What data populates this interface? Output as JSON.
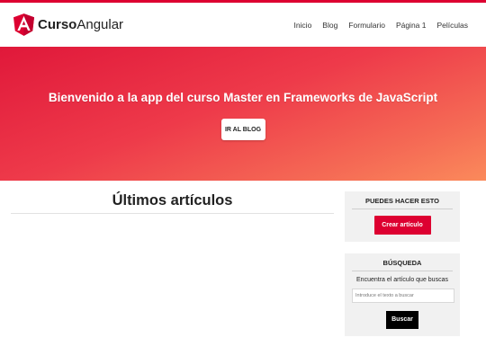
{
  "colors": {
    "accent": "#dd0031",
    "hero_start": "#e0183a",
    "hero_end": "#fb8a5b",
    "sidebar_bg": "#f1f1f1"
  },
  "brand": {
    "icon": "angular-logo-icon",
    "bold": "Curso",
    "regular": "Angular"
  },
  "nav": {
    "items": [
      "Inicio",
      "Blog",
      "Formulario",
      "Página 1",
      "Películas"
    ]
  },
  "hero": {
    "title": "Bienvenido a la app del curso Master en Frameworks de JavaScript",
    "button_label": "IR AL BLOG"
  },
  "content": {
    "title": "Últimos artículos"
  },
  "sidebar": {
    "actions": {
      "title": "PUEDES HACER ESTO",
      "button_label": "Crear artículo"
    },
    "search": {
      "title": "BÚSQUEDA",
      "text": "Encuentra el artículo que buscas",
      "placeholder": "Introduce el texto a buscar",
      "button_label": "Buscar"
    }
  }
}
